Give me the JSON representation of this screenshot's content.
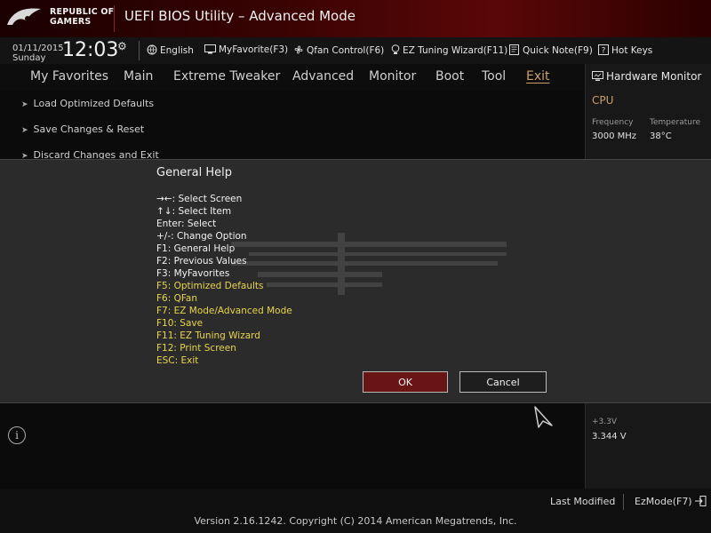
{
  "header": {
    "brand_line1": "REPUBLIC OF",
    "brand_line2": "GAMERS",
    "title": "UEFI BIOS Utility – Advanced Mode"
  },
  "status": {
    "date": "01/11/2015",
    "day": "Sunday",
    "time": "12:03"
  },
  "toolbar": {
    "language": "English",
    "my_favorite": "MyFavorite(F3)",
    "qfan": "Qfan Control(F6)",
    "ez_tuning": "EZ Tuning Wizard(F11)",
    "quick_note": "Quick Note(F9)",
    "hot_keys": "Hot Keys"
  },
  "tabs": [
    "My Favorites",
    "Main",
    "Extreme Tweaker",
    "Advanced",
    "Monitor",
    "Boot",
    "Tool",
    "Exit"
  ],
  "active_tab": "Exit",
  "menu_items": [
    "Load Optimized Defaults",
    "Save Changes & Reset",
    "Discard Changes and Exit"
  ],
  "monitor": {
    "title": "Hardware Monitor",
    "section": "CPU",
    "frequency_label": "Frequency",
    "frequency_value": "3000 MHz",
    "temperature_label": "Temperature",
    "temperature_value": "38°C",
    "voltage_label": "+3.3V",
    "voltage_value": "3.344 V"
  },
  "dialog": {
    "title": "General Help",
    "lines": [
      {
        "text": "→←: Select Screen",
        "color": "white"
      },
      {
        "text": "↑↓: Select Item",
        "color": "white"
      },
      {
        "text": "Enter: Select",
        "color": "white"
      },
      {
        "text": "+/-: Change Option",
        "color": "white"
      },
      {
        "text": "F1: General Help",
        "color": "white"
      },
      {
        "text": "F2: Previous Values",
        "color": "white"
      },
      {
        "text": "F3: MyFavorites",
        "color": "white"
      },
      {
        "text": "F5: Optimized Defaults",
        "color": "yellow"
      },
      {
        "text": "F6: QFan",
        "color": "yellow"
      },
      {
        "text": "F7: EZ Mode/Advanced Mode",
        "color": "yellow"
      },
      {
        "text": "F10: Save",
        "color": "yellow"
      },
      {
        "text": "F11: EZ Tuning Wizard",
        "color": "yellow"
      },
      {
        "text": "F12: Print Screen",
        "color": "yellow"
      },
      {
        "text": "ESC: Exit",
        "color": "yellow"
      }
    ],
    "ok_label": "OK",
    "cancel_label": "Cancel"
  },
  "footer": {
    "last_modified": "Last Modified",
    "ez_mode": "EzMode(F7)",
    "version": "Version 2.16.1242. Copyright (C) 2014 American Megatrends, Inc."
  },
  "colors": {
    "accent": "#c9a06a",
    "help_highlight": "#e8d54a",
    "ok_button": "#6a1515",
    "header_red": "#5a0707"
  }
}
